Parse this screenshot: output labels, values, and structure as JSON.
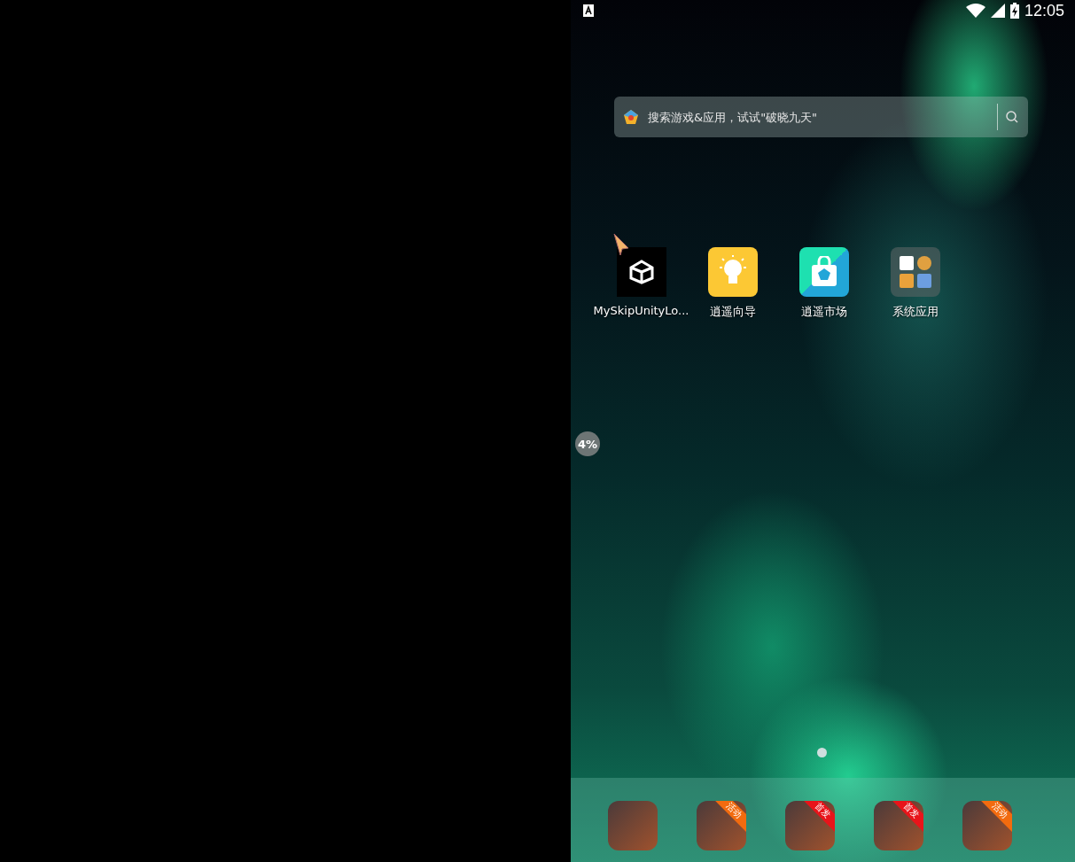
{
  "status_bar": {
    "time": "12:05"
  },
  "search": {
    "placeholder": "搜索游戏&应用，试试\"破晓九天\""
  },
  "apps": [
    {
      "label": "MySkipUnityLo...",
      "kind": "unity"
    },
    {
      "label": "逍遥向导",
      "kind": "bulb"
    },
    {
      "label": "逍遥市场",
      "kind": "market"
    },
    {
      "label": "系统应用",
      "kind": "folder"
    }
  ],
  "float_bubble": {
    "text": "4%"
  },
  "pages": [
    {
      "selected": true
    }
  ],
  "dock": [
    {
      "kind": "game"
    },
    {
      "kind": "game",
      "badge": {
        "text": "活动",
        "color": "#f26b0f"
      }
    },
    {
      "kind": "game",
      "badge": {
        "text": "首发",
        "color": "#e8141a"
      }
    },
    {
      "kind": "game",
      "badge": {
        "text": "首发",
        "color": "#e8141a"
      }
    },
    {
      "kind": "game",
      "badge": {
        "text": "活动",
        "color": "#f26b0f"
      }
    }
  ]
}
